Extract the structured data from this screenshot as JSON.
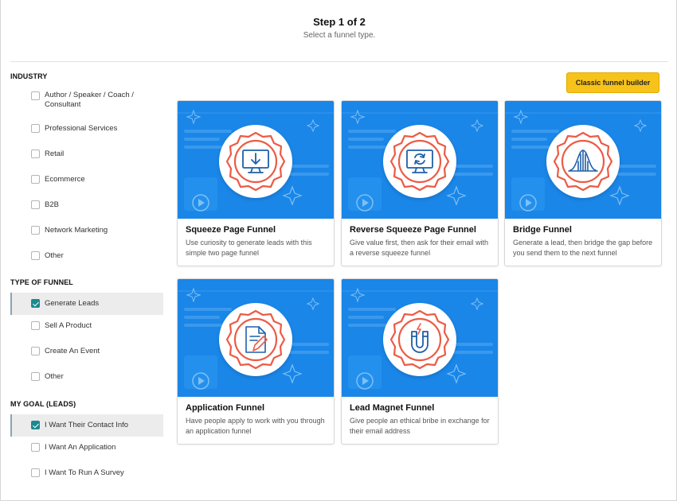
{
  "header": {
    "title": "Step 1 of 2",
    "subtitle": "Select a funnel type."
  },
  "sidebar": {
    "industry": {
      "title": "INDUSTRY",
      "items": [
        {
          "label": "Author / Speaker / Coach / Consultant",
          "checked": false
        },
        {
          "label": "Professional Services",
          "checked": false
        },
        {
          "label": "Retail",
          "checked": false
        },
        {
          "label": "Ecommerce",
          "checked": false
        },
        {
          "label": "B2B",
          "checked": false
        },
        {
          "label": "Network Marketing",
          "checked": false
        },
        {
          "label": "Other",
          "checked": false
        }
      ]
    },
    "type_of_funnel": {
      "title": "TYPE OF FUNNEL",
      "items": [
        {
          "label": "Generate Leads",
          "checked": true
        },
        {
          "label": "Sell A Product",
          "checked": false
        },
        {
          "label": "Create An Event",
          "checked": false
        },
        {
          "label": "Other",
          "checked": false
        }
      ]
    },
    "my_goal": {
      "title": "MY GOAL (LEADS)",
      "items": [
        {
          "label": "I Want Their Contact Info",
          "checked": true
        },
        {
          "label": "I Want An Application",
          "checked": false
        },
        {
          "label": "I Want To Run A Survey",
          "checked": false
        }
      ]
    }
  },
  "actions": {
    "classic_label": "Classic funnel builder"
  },
  "cards": [
    {
      "name": "Squeeze Page Funnel",
      "desc": "Use curiosity to generate leads with this simple two page funnel",
      "icon": "monitor-download-icon"
    },
    {
      "name": "Reverse Squeeze Page Funnel",
      "desc": "Give value first, then ask for their email with a reverse squeeze funnel",
      "icon": "monitor-refresh-icon"
    },
    {
      "name": "Bridge Funnel",
      "desc": "Generate a lead, then bridge the gap before you send them to the next funnel",
      "icon": "bell-curve-icon"
    },
    {
      "name": "Application Funnel",
      "desc": "Have people apply to work with you through an application funnel",
      "icon": "document-pen-icon"
    },
    {
      "name": "Lead Magnet Funnel",
      "desc": "Give people an ethical bribe in exchange for their email address",
      "icon": "magnet-icon"
    }
  ],
  "colors": {
    "card_art": "#1a86e8",
    "icon_stroke": "#ec5b45",
    "accent_button": "#f7c31a",
    "checkbox_checked": "#1a8a8f"
  }
}
